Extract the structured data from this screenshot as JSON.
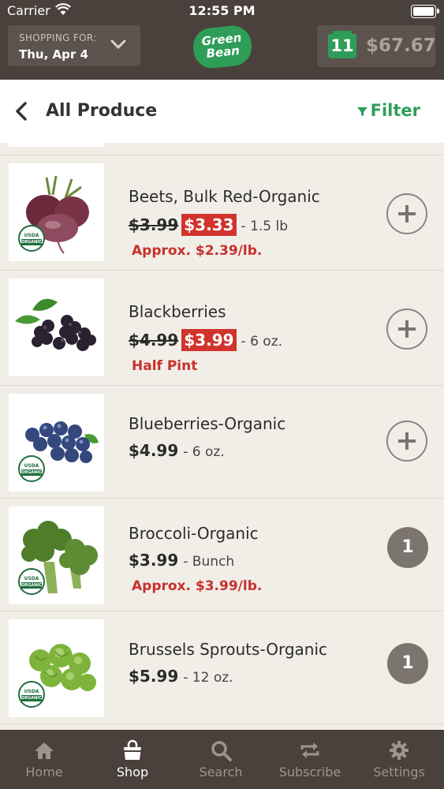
{
  "status_bar": {
    "carrier": "Carrier",
    "time": "12:55 PM"
  },
  "header": {
    "shopping_for_label": "SHOPPING FOR:",
    "shopping_for_date": "Thu, Apr 4",
    "logo_line1": "Green",
    "logo_line2": "Bean",
    "cart_count": "11",
    "cart_total": "$67.67",
    "brand_color": "#2e9d58"
  },
  "title_bar": {
    "title": "All Produce",
    "filter_label": "Filter"
  },
  "products": [
    {
      "name": "Beets, Bulk Red-Organic",
      "old_price": "$3.99",
      "price": "$3.33",
      "unit": "- 1.5 lb",
      "note": "Approx. $2.39/lb.",
      "organic": true,
      "button": "add"
    },
    {
      "name": "Blackberries",
      "old_price": "$4.99",
      "price": "$3.99",
      "unit": "- 6 oz.",
      "note": "Half Pint",
      "organic": false,
      "button": "add"
    },
    {
      "name": "Blueberries-Organic",
      "price": "$4.99",
      "unit": "- 6 oz.",
      "organic": true,
      "button": "add"
    },
    {
      "name": "Broccoli-Organic",
      "price": "$3.99",
      "unit": "- Bunch",
      "note": "Approx. $3.99/lb.",
      "organic": true,
      "button": "qty",
      "qty": "1"
    },
    {
      "name": "Brussels Sprouts-Organic",
      "price": "$5.99",
      "unit": "- 12 oz.",
      "organic": true,
      "button": "qty",
      "qty": "1"
    }
  ],
  "usda_badge": {
    "line1": "USDA",
    "line2": "ORGANIC"
  },
  "tabs": [
    {
      "label": "Home",
      "icon": "home-icon"
    },
    {
      "label": "Shop",
      "icon": "shopping-bag-icon",
      "active": true
    },
    {
      "label": "Search",
      "icon": "search-icon"
    },
    {
      "label": "Subscribe",
      "icon": "repeat-icon"
    },
    {
      "label": "Settings",
      "icon": "gear-icon"
    }
  ]
}
